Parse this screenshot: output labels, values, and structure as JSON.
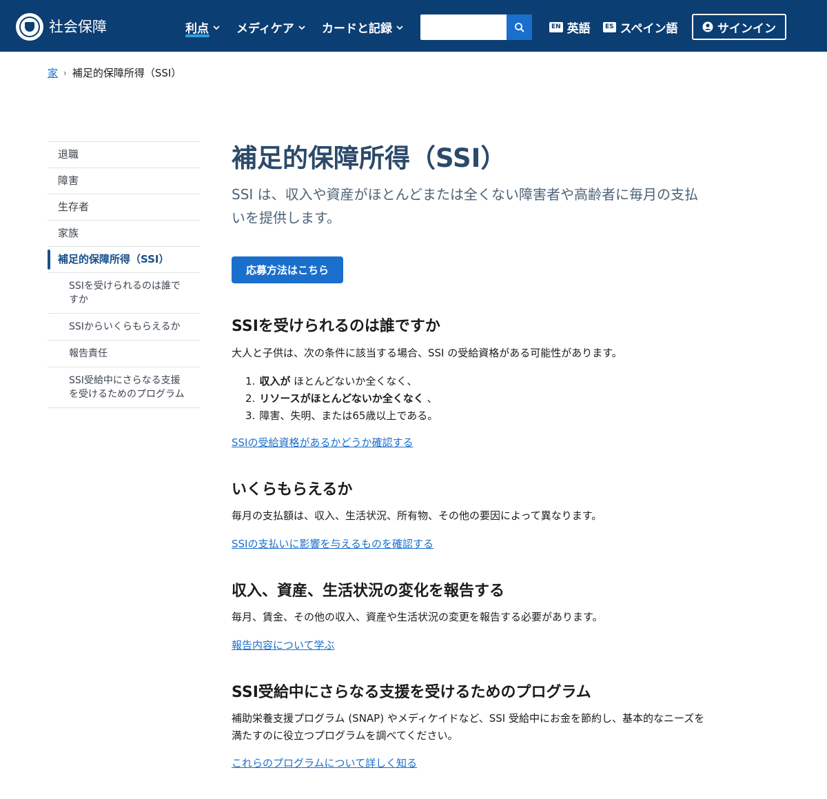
{
  "header": {
    "brand": "社会保障",
    "nav": [
      {
        "label": "利点"
      },
      {
        "label": "メディケア"
      },
      {
        "label": "カードと記録"
      }
    ],
    "search_placeholder": "",
    "languages": [
      {
        "badge": "EN",
        "label": "英語"
      },
      {
        "badge": "ES",
        "label": "スペイン語"
      }
    ],
    "signin_label": "サインイン"
  },
  "breadcrumb": {
    "home": "家",
    "current": "補足的保障所得（SSI）"
  },
  "sidebar": {
    "items": [
      {
        "label": "退職"
      },
      {
        "label": "障害"
      },
      {
        "label": "生存者"
      },
      {
        "label": "家族"
      },
      {
        "label": "補足的保障所得（SSI）"
      },
      {
        "label": "SSIを受けられるのは誰ですか"
      },
      {
        "label": "SSIからいくらもらえるか"
      },
      {
        "label": "報告責任"
      },
      {
        "label": "SSI受給中にさらなる支援を受けるためのプログラム"
      }
    ]
  },
  "main": {
    "title": "補足的保障所得（SSI）",
    "lead": "SSI は、収入や資産がほとんどまたは全くない障害者や高齢者に毎月の支払いを提供します。",
    "apply_button": "応募方法はこちら",
    "sections": [
      {
        "heading": "SSIを受けられるのは誰ですか",
        "text": "大人と子供は、次の条件に該当する場合、SSI の受給資格がある可能性があります。",
        "link": "SSIの受給資格があるかどうか確認する"
      },
      {
        "heading": "いくらもらえるか",
        "text": "毎月の支払額は、収入、生活状況、所有物、その他の要因によって異なります。",
        "link": "SSIの支払いに影響を与えるものを確認する"
      },
      {
        "heading": "収入、資産、生活状況の変化を報告する",
        "text": "毎月、賃金、その他の収入、資産や生活状況の変更を報告する必要があります。",
        "link": "報告内容について学ぶ"
      },
      {
        "heading": "SSI受給中にさらなる支援を受けるためのプログラム",
        "text": "補助栄養支援プログラム (SNAP) やメディケイドなど、SSI 受給中にお金を節約し、基本的なニーズを満たすのに役立つプログラムを調べてください。",
        "link": "これらのプログラムについて詳しく知る"
      }
    ],
    "conditions": [
      {
        "num": "1.",
        "bold": "収入が",
        "rest": " ほとんどないか全くなく、"
      },
      {
        "num": "2.",
        "bold": "リソースがほとんどないか全くなく",
        "rest": " 、"
      },
      {
        "num": "3.",
        "bold": "",
        "rest": "障害、失明、または65歳以上である。"
      }
    ]
  }
}
